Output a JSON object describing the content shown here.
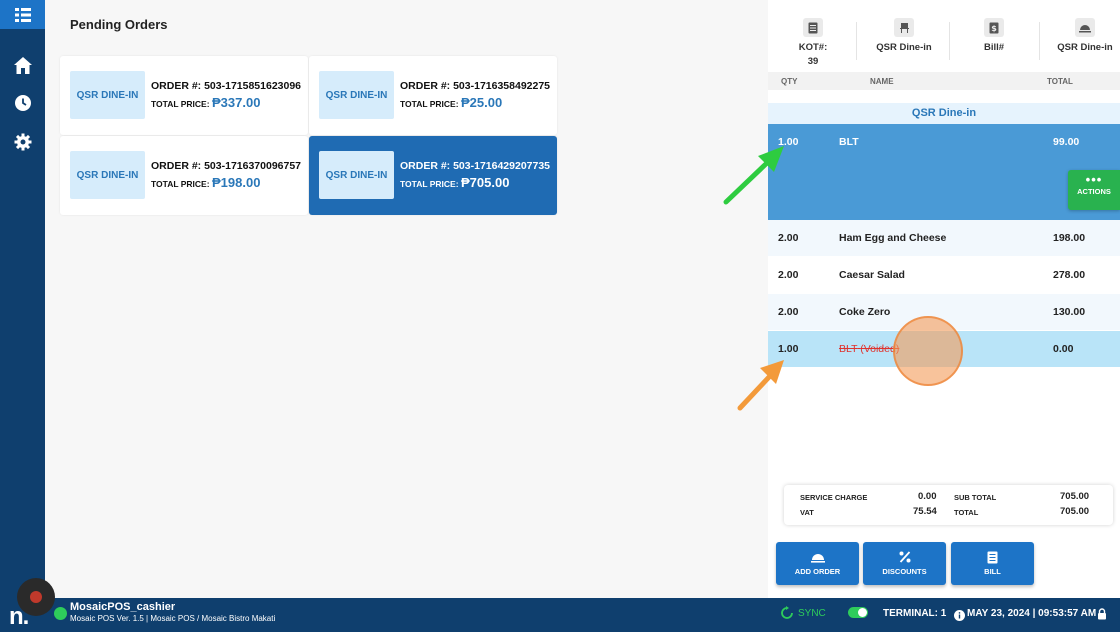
{
  "main": {
    "title": "Pending Orders",
    "orders": [
      {
        "tag": "QSR DINE-IN",
        "order_no": "ORDER #: 503-1715851623096",
        "total_label": "TOTAL PRICE:",
        "total": "₱337.00",
        "selected": false
      },
      {
        "tag": "QSR DINE-IN",
        "order_no": "ORDER #: 503-1716358492275",
        "total_label": "TOTAL PRICE:",
        "total": "₱25.00",
        "selected": false
      },
      {
        "tag": "QSR DINE-IN",
        "order_no": "ORDER #: 503-1716370096757",
        "total_label": "TOTAL PRICE:",
        "total": "₱198.00",
        "selected": false
      },
      {
        "tag": "QSR DINE-IN",
        "order_no": "ORDER #: 503-1716429207735",
        "total_label": "TOTAL PRICE:",
        "total": "₱705.00",
        "selected": true
      }
    ]
  },
  "panel": {
    "header": [
      {
        "label": "KOT#:",
        "value": "39",
        "icon": "document-icon"
      },
      {
        "label": "QSR Dine-in",
        "value": "",
        "icon": "chair-icon"
      },
      {
        "label": "Bill#",
        "value": "",
        "icon": "bill-icon"
      },
      {
        "label": "QSR Dine-in",
        "value": "",
        "icon": "cloche-icon"
      }
    ],
    "columns": {
      "qty": "QTY",
      "name": "NAME",
      "total": "TOTAL"
    },
    "group_title": "QSR Dine-in",
    "items": [
      {
        "qty": "1.00",
        "name": "BLT",
        "total": "99.00",
        "state": "selected"
      },
      {
        "qty": "2.00",
        "name": "Ham Egg and Cheese",
        "total": "198.00",
        "state": "alt"
      },
      {
        "qty": "2.00",
        "name": "Caesar Salad",
        "total": "278.00",
        "state": "normal"
      },
      {
        "qty": "2.00",
        "name": "Coke Zero",
        "total": "130.00",
        "state": "alt"
      },
      {
        "qty": "1.00",
        "name": "BLT",
        "voided_tag": "(Voided)",
        "total": "0.00",
        "state": "voided"
      }
    ],
    "actions_label": "ACTIONS",
    "totals": {
      "service_charge_label": "SERVICE CHARGE",
      "service_charge": "0.00",
      "vat_label": "VAT",
      "vat": "75.54",
      "sub_total_label": "SUB TOTAL",
      "sub_total": "705.00",
      "total_label": "TOTAL",
      "total": "705.00"
    },
    "buttons": {
      "add_order": "ADD ORDER",
      "discounts": "DISCOUNTS",
      "bill": "BILL"
    }
  },
  "status": {
    "user": "MosaicPOS_cashier",
    "version": "Mosaic POS Ver. 1.5 | Mosaic POS / Mosaic Bistro Makati",
    "sync": "SYNC",
    "terminal": "TERMINAL: 1",
    "datetime": "MAY 23, 2024 | 09:53:57 AM",
    "logo": "n."
  },
  "colors": {
    "primary": "#1d74c7",
    "sidebar": "#0f3f6e",
    "selected_row": "#4a9ad6",
    "actions": "#29b24f",
    "voided": "#e0322d"
  }
}
